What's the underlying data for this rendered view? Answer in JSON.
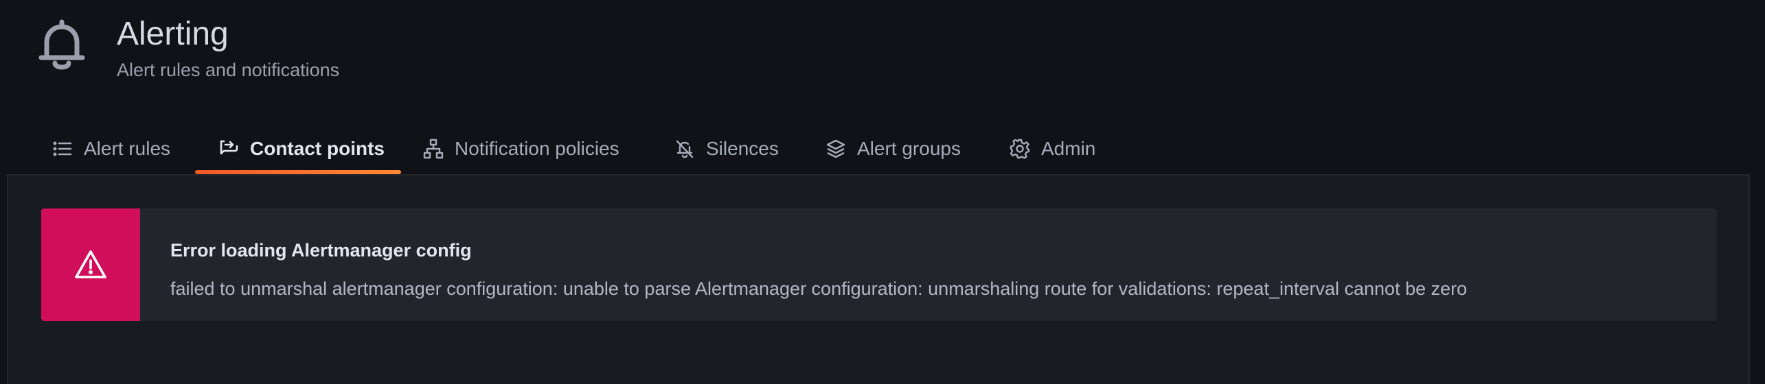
{
  "header": {
    "icon": "bell-icon",
    "title": "Alerting",
    "subtitle": "Alert rules and notifications"
  },
  "tabs": [
    {
      "label": "Alert rules",
      "icon": "list-icon",
      "active": false
    },
    {
      "label": "Contact points",
      "icon": "comment-alt-share-icon",
      "active": true
    },
    {
      "label": "Notification policies",
      "icon": "sitemap-icon",
      "active": false
    },
    {
      "label": "Silences",
      "icon": "bell-slash-icon",
      "active": false
    },
    {
      "label": "Alert groups",
      "icon": "layer-group-icon",
      "active": false
    },
    {
      "label": "Admin",
      "icon": "cog-icon",
      "active": false
    }
  ],
  "alert": {
    "severity": "error",
    "icon": "exclamation-triangle-icon",
    "title": "Error loading Alertmanager config",
    "message": "failed to unmarshal alertmanager configuration: unable to parse Alertmanager configuration: unmarshaling route for validations: repeat_interval cannot be zero"
  },
  "colors": {
    "background": "#111217",
    "panel": "#181b1f",
    "alert_background": "#22252b",
    "error_accent": "#d10e5c",
    "active_tab_underline": "#f05a28"
  }
}
